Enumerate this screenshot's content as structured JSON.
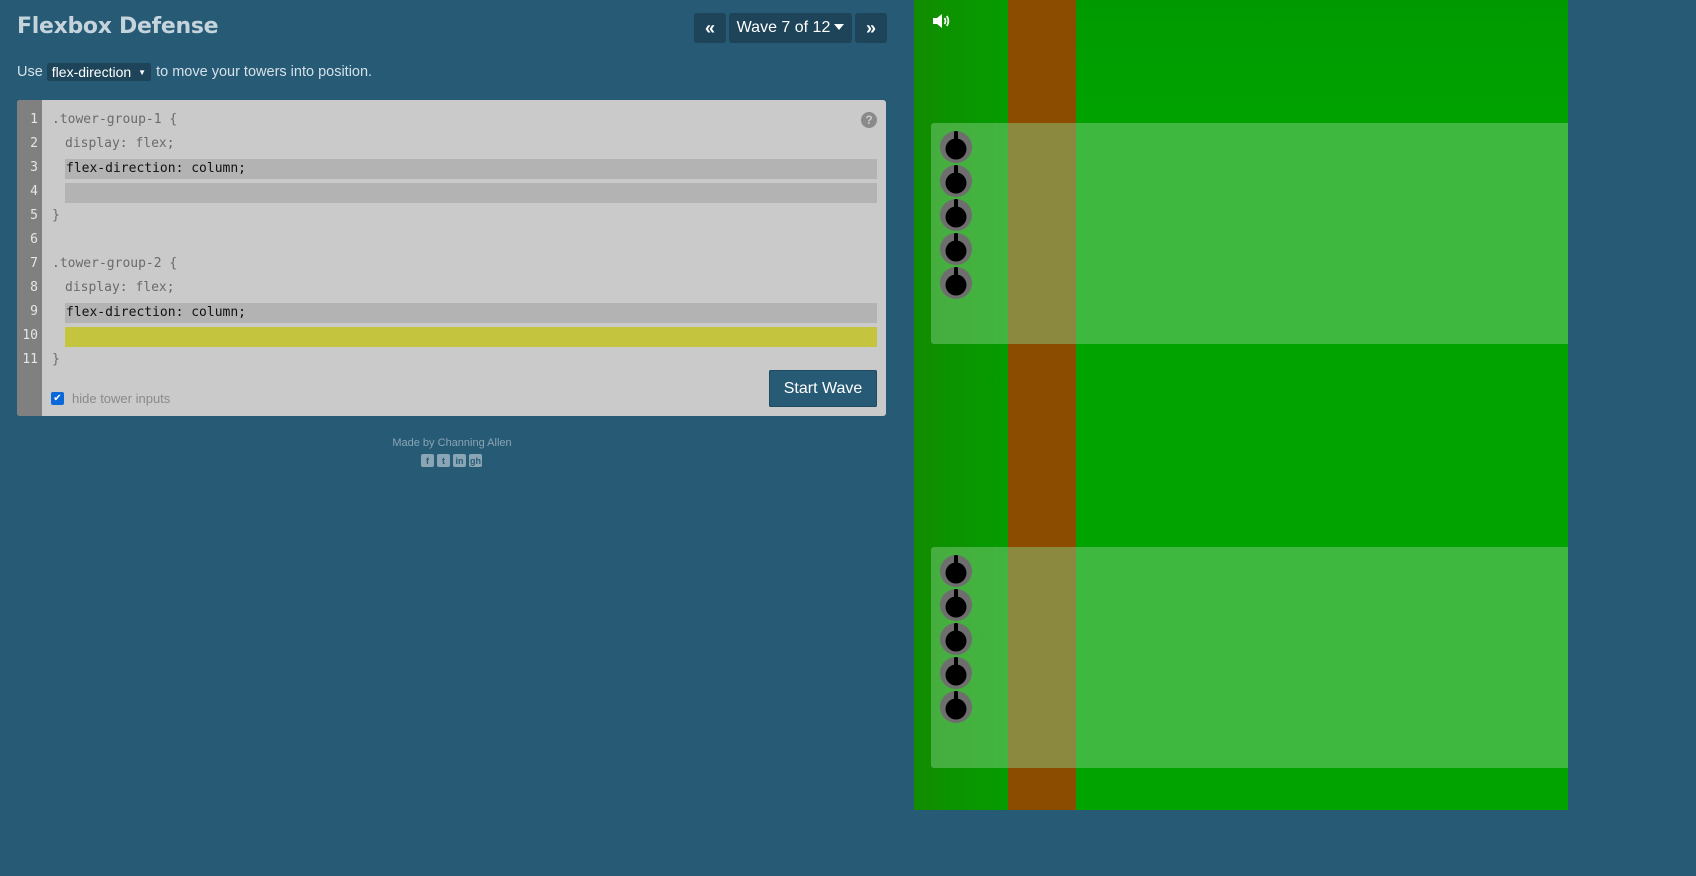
{
  "header": {
    "title": "Flexbox Defense",
    "prev_label": "«",
    "next_label": "»",
    "wave_label": "Wave 7 of 12"
  },
  "instruction": {
    "before": "Use",
    "property": "flex-direction",
    "after": "to move your towers into position."
  },
  "editor": {
    "line_numbers": [
      "1",
      "2",
      "3",
      "4",
      "5",
      "6",
      "7",
      "8",
      "9",
      "10",
      "11"
    ],
    "group1_selector": ".tower-group-1 {",
    "group1_display": "display: flex;",
    "group1_input1": "flex-direction: column;",
    "group1_input2": "",
    "group1_close": "}",
    "group2_selector": ".tower-group-2 {",
    "group2_display": "display: flex;",
    "group2_input1": "flex-direction: column;",
    "group2_input2": "",
    "group2_close": "}",
    "help": "?",
    "hide_inputs_label": "hide tower inputs",
    "hide_inputs_checked": true,
    "start_label": "Start Wave"
  },
  "footer": {
    "made_by": "Made by",
    "author": "Channing Allen",
    "social_icons": [
      "facebook-icon",
      "twitter-icon",
      "linkedin-icon",
      "github-icon"
    ],
    "social_glyphs": [
      "f",
      "t",
      "in",
      "gh"
    ]
  },
  "board": {
    "sound": "volume-on-icon",
    "tower_group_1_count": 5,
    "tower_group_2_count": 5
  },
  "colors": {
    "panel_bg": "#265a75",
    "button_bg": "#1d4459",
    "grass": "#00a300",
    "road": "#8b4c00",
    "active_input": "#c5c43e",
    "inactive_input": "#b3b3b3"
  }
}
